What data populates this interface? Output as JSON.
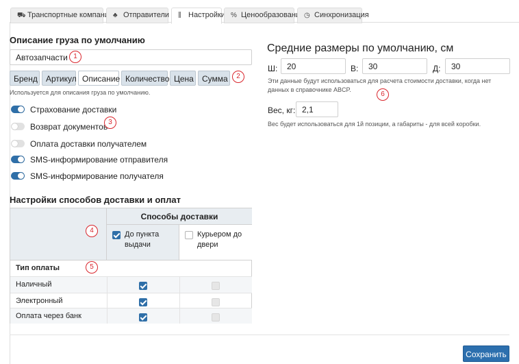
{
  "tabs": [
    {
      "label": "Транспортные компании",
      "icon": "truck-icon",
      "glyph": "⛟"
    },
    {
      "label": "Отправители",
      "icon": "user-icon",
      "glyph": "♣"
    },
    {
      "label": "Настройки",
      "icon": "sliders-icon",
      "glyph": "⫼"
    },
    {
      "label": "Ценообразование",
      "icon": "percent-icon",
      "glyph": "%"
    },
    {
      "label": "Синхронизация",
      "icon": "clock-icon",
      "glyph": "◷"
    }
  ],
  "cargo": {
    "title": "Описание груза по умолчанию",
    "value": "Автозапчасти",
    "chips": [
      {
        "label": "Бренд",
        "selected": true
      },
      {
        "label": "Артикул",
        "selected": true
      },
      {
        "label": "Описание",
        "selected": false
      },
      {
        "label": "Количество",
        "selected": true
      },
      {
        "label": "Цена",
        "selected": true
      },
      {
        "label": "Сумма",
        "selected": true
      }
    ],
    "hint": "Используется для описания груза по умолчанию."
  },
  "toggles": [
    {
      "label": "Страхование доставки",
      "on": true
    },
    {
      "label": "Возврат документов",
      "on": false
    },
    {
      "label": "Оплата доставки получателем",
      "on": false
    },
    {
      "label": "SMS-информирование отправителя",
      "on": true
    },
    {
      "label": "SMS-информирование получателя",
      "on": true
    }
  ],
  "delivery": {
    "title": "Настройки способов доставки и оплат",
    "methods_header": "Способы доставки",
    "method1": {
      "label": "До пункта выдачи",
      "checked": true
    },
    "method2": {
      "label": "Курьером до двери",
      "checked": false
    },
    "payment_header": "Тип оплаты",
    "payments": [
      {
        "label": "Наличный",
        "m1": true,
        "m2": false
      },
      {
        "label": "Электронный",
        "m1": true,
        "m2": false
      },
      {
        "label": "Оплата через банк",
        "m1": true,
        "m2": false
      }
    ]
  },
  "dimensions": {
    "title": "Средние размеры по умолчанию, см",
    "w_label": "Ш:",
    "w_value": "20",
    "h_label": "В:",
    "h_value": "30",
    "d_label": "Д:",
    "d_value": "30",
    "hint": "Эти данные будут использоваться для расчета стоимости доставки, когда нет данных в справочнике ABCP.",
    "weight_label": "Вес, кг:",
    "weight_value": "2,1",
    "weight_hint": "Вес будет использоваться для 1й позиции, а габариты - для всей коробки."
  },
  "markers": [
    "1",
    "2",
    "3",
    "4",
    "5",
    "6"
  ],
  "save_label": "Сохранить",
  "colors": {
    "accent": "#2f6fa8",
    "marker": "#d9252c",
    "chip_bg": "#d9e2ea"
  }
}
